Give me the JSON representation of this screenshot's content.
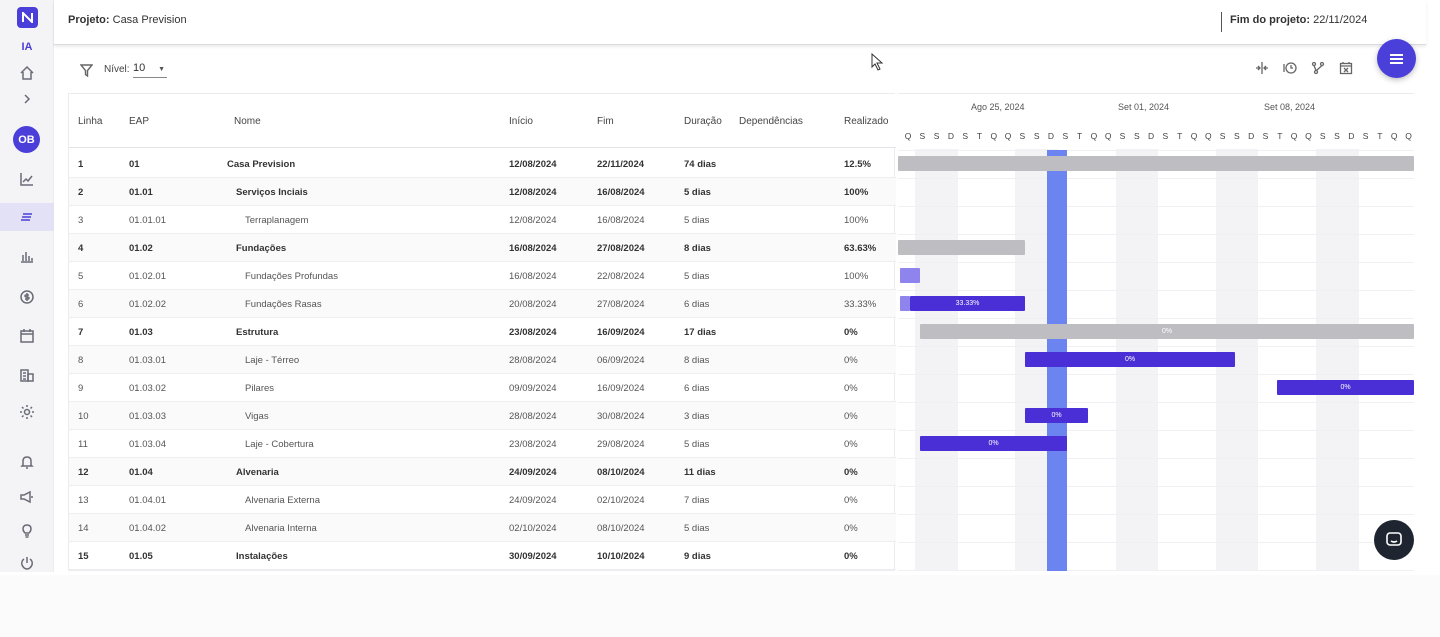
{
  "header": {
    "project_label": "Projeto:",
    "project_name": "Casa Prevision",
    "end_label": "Fim do projeto:",
    "end_date": "22/11/2024"
  },
  "sidebar": {
    "ia_label": "IA",
    "avatar_initials": "OB"
  },
  "toolbar": {
    "level_label": "Nível:",
    "level_value": "10"
  },
  "table": {
    "columns": [
      "Linha",
      "EAP",
      "Nome",
      "Início",
      "Fim",
      "Duração",
      "Dependências",
      "Realizado"
    ],
    "rows": [
      {
        "linha": "1",
        "eap": "01",
        "nome": "Casa Prevision",
        "inicio": "12/08/2024",
        "fim": "22/11/2024",
        "duracao": "74 dias",
        "realizado": "12.5%",
        "level": 0,
        "bold": true
      },
      {
        "linha": "2",
        "eap": "01.01",
        "nome": "Serviços Inciais",
        "inicio": "12/08/2024",
        "fim": "16/08/2024",
        "duracao": "5 dias",
        "realizado": "100%",
        "level": 1,
        "bold": true
      },
      {
        "linha": "3",
        "eap": "01.01.01",
        "nome": "Terraplanagem",
        "inicio": "12/08/2024",
        "fim": "16/08/2024",
        "duracao": "5 dias",
        "realizado": "100%",
        "level": 2,
        "bold": false
      },
      {
        "linha": "4",
        "eap": "01.02",
        "nome": "Fundações",
        "inicio": "16/08/2024",
        "fim": "27/08/2024",
        "duracao": "8 dias",
        "realizado": "63.63%",
        "level": 1,
        "bold": true
      },
      {
        "linha": "5",
        "eap": "01.02.01",
        "nome": "Fundações Profundas",
        "inicio": "16/08/2024",
        "fim": "22/08/2024",
        "duracao": "5 dias",
        "realizado": "100%",
        "level": 2,
        "bold": false
      },
      {
        "linha": "6",
        "eap": "01.02.02",
        "nome": "Fundações Rasas",
        "inicio": "20/08/2024",
        "fim": "27/08/2024",
        "duracao": "6 dias",
        "realizado": "33.33%",
        "level": 2,
        "bold": false
      },
      {
        "linha": "7",
        "eap": "01.03",
        "nome": "Estrutura",
        "inicio": "23/08/2024",
        "fim": "16/09/2024",
        "duracao": "17 dias",
        "realizado": "0%",
        "level": 1,
        "bold": true
      },
      {
        "linha": "8",
        "eap": "01.03.01",
        "nome": "Laje - Térreo",
        "inicio": "28/08/2024",
        "fim": "06/09/2024",
        "duracao": "8 dias",
        "realizado": "0%",
        "level": 2,
        "bold": false
      },
      {
        "linha": "9",
        "eap": "01.03.02",
        "nome": "Pilares",
        "inicio": "09/09/2024",
        "fim": "16/09/2024",
        "duracao": "6 dias",
        "realizado": "0%",
        "level": 2,
        "bold": false
      },
      {
        "linha": "10",
        "eap": "01.03.03",
        "nome": "Vigas",
        "inicio": "28/08/2024",
        "fim": "30/08/2024",
        "duracao": "3 dias",
        "realizado": "0%",
        "level": 2,
        "bold": false
      },
      {
        "linha": "11",
        "eap": "01.03.04",
        "nome": "Laje - Cobertura",
        "inicio": "23/08/2024",
        "fim": "29/08/2024",
        "duracao": "5 dias",
        "realizado": "0%",
        "level": 2,
        "bold": false
      },
      {
        "linha": "12",
        "eap": "01.04",
        "nome": "Alvenaria",
        "inicio": "24/09/2024",
        "fim": "08/10/2024",
        "duracao": "11 dias",
        "realizado": "0%",
        "level": 1,
        "bold": true
      },
      {
        "linha": "13",
        "eap": "01.04.01",
        "nome": "Alvenaria Externa",
        "inicio": "24/09/2024",
        "fim": "02/10/2024",
        "duracao": "7 dias",
        "realizado": "0%",
        "level": 2,
        "bold": false
      },
      {
        "linha": "14",
        "eap": "01.04.02",
        "nome": "Alvenaria Interna",
        "inicio": "02/10/2024",
        "fim": "08/10/2024",
        "duracao": "5 dias",
        "realizado": "0%",
        "level": 2,
        "bold": false
      },
      {
        "linha": "15",
        "eap": "01.05",
        "nome": "Instalações",
        "inicio": "30/09/2024",
        "fim": "10/10/2024",
        "duracao": "9 dias",
        "realizado": "0%",
        "level": 1,
        "bold": true
      }
    ]
  },
  "gantt": {
    "weeks": [
      "Ago 25, 2024",
      "Set 01, 2024",
      "Set 08, 2024"
    ],
    "days": [
      "Q",
      "S",
      "S",
      "D",
      "S",
      "T",
      "Q",
      "Q",
      "S",
      "S",
      "D",
      "S",
      "T",
      "Q",
      "Q",
      "S",
      "S",
      "D",
      "S",
      "T",
      "Q",
      "Q",
      "S",
      "S",
      "D",
      "S",
      "T",
      "Q",
      "Q",
      "S",
      "S",
      "D",
      "S",
      "T",
      "Q",
      "Q",
      "S",
      "S"
    ],
    "bar_labels": {
      "r6": "33.33%",
      "r7": "0%",
      "r8": "0%",
      "r9": "0%",
      "r10": "0%",
      "r11": "0%"
    }
  },
  "colors": {
    "brand": "#4a3fd8",
    "today_marker": "#6b84f0",
    "summary_bar": "#bdbdc2",
    "task_bar": "#4a2ed6",
    "done_bar": "#8f83ee"
  }
}
